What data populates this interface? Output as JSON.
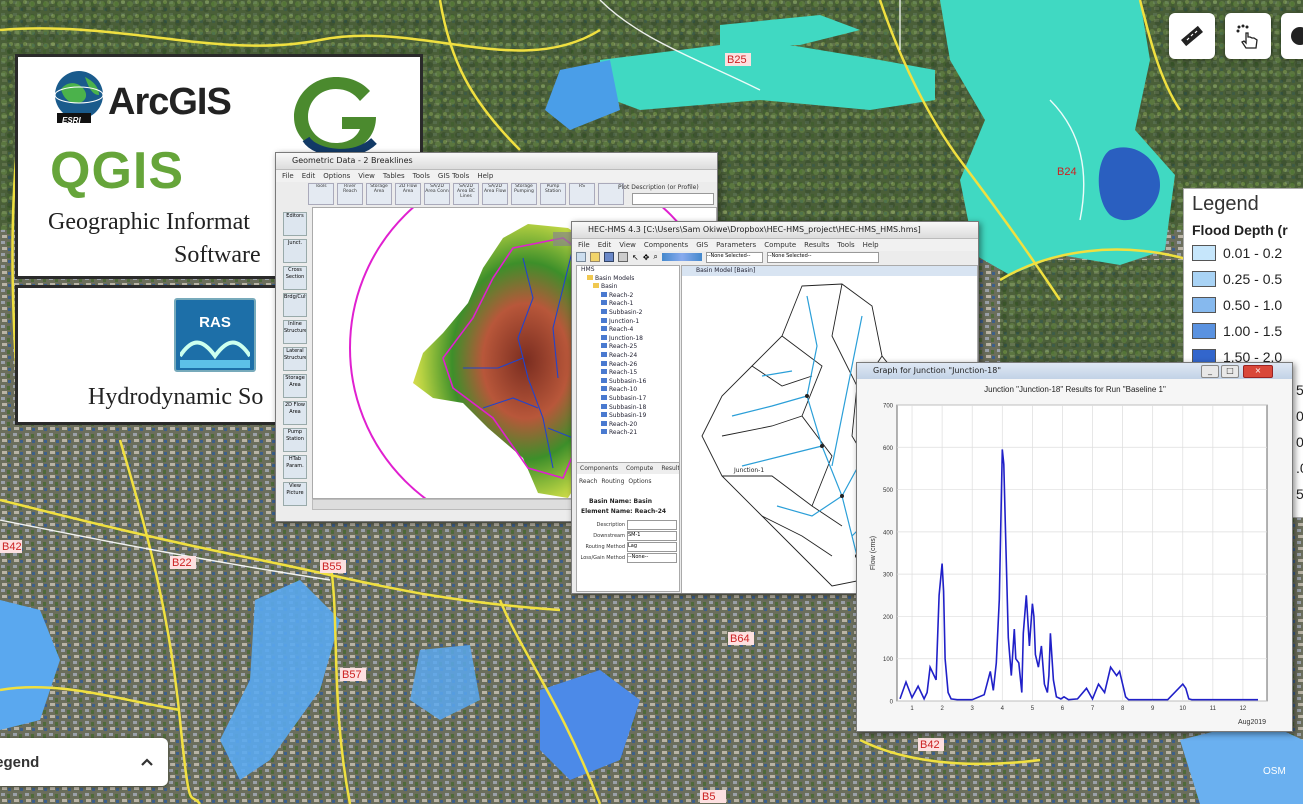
{
  "map": {
    "region_labels": [
      "B25",
      "B24",
      "B22",
      "B42",
      "B55",
      "B64",
      "B57",
      "B42",
      "B5"
    ],
    "osm_badge": "OSM",
    "legend_bar": {
      "label": "Legend"
    }
  },
  "legend_panel": {
    "title": "Legend",
    "subtitle": "Flood Depth (r",
    "items": [
      {
        "label": "0.01 - 0.2",
        "color": "#c6e6fb"
      },
      {
        "label": "0.25 - 0.5",
        "color": "#a9d3f5"
      },
      {
        "label": "0.50 - 1.0",
        "color": "#86b9ee"
      },
      {
        "label": "1.00 - 1.5",
        "color": "#5a92e0"
      },
      {
        "label": "1.50 - 2.0",
        "color": "#3366cc"
      }
    ],
    "clipped_digits": [
      "5",
      "0",
      "0",
      ".0",
      "5.0"
    ]
  },
  "software_panel": {
    "arcgis_label": "ArcGIS",
    "esri_label": "ESRI",
    "qgis_label": "QGIS",
    "caption_line1": "Geographic Informat",
    "caption_line2": "Software"
  },
  "hydro_panel": {
    "ras_label": "RAS",
    "caption": "Hydrodynamic So"
  },
  "geometric_window": {
    "title": "Geometric Data - 2 Breaklines",
    "menu": [
      "File",
      "Edit",
      "Options",
      "View",
      "Tables",
      "Tools",
      "GIS Tools",
      "Help"
    ],
    "tool_tabs": [
      "Tools",
      "River Reach",
      "Storage Area",
      "2D Flow Area",
      "SA/2D Area Conn",
      "SA/2D Area BC Lines",
      "SA/2D Area Flow",
      "Storage Pumping",
      "Pump Station",
      "RS",
      ""
    ],
    "profile_label": "Plot Description (or Profile)",
    "side_tools": [
      "Editors",
      "Junct.",
      "Cross Section",
      "Brdg/Culv",
      "Inline Structure",
      "Lateral Structure",
      "Storage Area",
      "2D Flow Area",
      "Pump Station",
      "HTab Param.",
      "View Picture"
    ]
  },
  "hms_window": {
    "title": "HEC-HMS 4.3 [C:\\Users\\Sam Okiwe\\Dropbox\\HEC-HMS_project\\HEC-HMS_HMS.hms]",
    "menu": [
      "File",
      "Edit",
      "View",
      "Components",
      "GIS",
      "Parameters",
      "Compute",
      "Results",
      "Tools",
      "Help"
    ],
    "dropdown1": "--None Selected--",
    "dropdown2": "--None Selected--",
    "tree_root": "HMS",
    "tree": [
      "Basin Models",
      "Basin",
      "Reach-2",
      "Reach-1",
      "Subbasin-2",
      "Junction-1",
      "Reach-4",
      "Junction-18",
      "Reach-25",
      "Reach-24",
      "Reach-26",
      "Reach-15",
      "Subbasin-16",
      "Reach-10",
      "Subbasin-17",
      "Subbasin-18",
      "Subbasin-19",
      "Reach-20",
      "Reach-21"
    ],
    "tabs": [
      "Components",
      "Compute",
      "Results"
    ],
    "prop_tabs": [
      "Reach",
      "Routing",
      "Options"
    ],
    "basin_name_label": "Basin Name: Basin",
    "element_name_label": "Element Name: Reach-24",
    "fields": [
      {
        "label": "Description",
        "value": ""
      },
      {
        "label": "Downstream",
        "value": "SM-1"
      },
      {
        "label": "Routing Method",
        "value": "Lag"
      },
      {
        "label": "Loss/Gain Method",
        "value": "--None--"
      }
    ],
    "basin_view_title": "Basin Model [Basin]",
    "junction_label": "Junction-1"
  },
  "graph_window": {
    "title": "Graph for Junction \"Junction-18\"",
    "buttons": [
      "_",
      "□",
      "×"
    ]
  },
  "chart_data": {
    "type": "line",
    "title": "Junction \"Junction-18\" Results for Run \"Baseline 1\"",
    "ylabel": "Flow (cms)",
    "xlabel": "Aug2019",
    "x_ticks": [
      "1",
      "2",
      "3",
      "4",
      "5",
      "6",
      "7",
      "8",
      "9",
      "10",
      "11",
      "12"
    ],
    "y_ticks": [
      "0",
      "100",
      "200",
      "300",
      "400",
      "500",
      "600",
      "700"
    ],
    "xlim": [
      0.5,
      12.8
    ],
    "ylim": [
      0,
      700
    ],
    "color": "#2020c8",
    "series": [
      {
        "x": [
          0.6,
          0.8,
          1.0,
          1.2,
          1.4,
          1.5,
          1.6,
          1.8,
          1.9,
          2.0,
          2.05,
          2.1,
          2.2,
          2.3,
          2.5,
          3.0,
          3.4,
          3.6,
          3.7,
          3.8,
          3.9,
          4.0,
          4.05,
          4.1,
          4.2,
          4.3,
          4.4,
          4.45,
          4.55,
          4.65,
          4.7,
          4.8,
          4.9,
          5.0,
          5.05,
          5.1,
          5.2,
          5.3,
          5.4,
          5.5,
          5.55,
          5.6,
          5.7,
          5.8,
          5.95,
          6.05,
          6.2,
          6.5,
          6.8,
          7.0,
          7.2,
          7.4,
          7.6,
          7.8,
          7.9,
          8.0,
          8.1,
          8.2,
          8.4,
          8.6,
          9.0,
          9.5,
          10.0,
          10.1,
          10.2,
          10.3,
          10.5,
          11.0,
          11.5,
          12.0,
          12.5
        ],
        "y": [
          5,
          45,
          8,
          35,
          5,
          20,
          80,
          50,
          250,
          325,
          260,
          100,
          20,
          5,
          3,
          3,
          15,
          70,
          25,
          90,
          240,
          595,
          560,
          420,
          150,
          60,
          170,
          100,
          90,
          20,
          160,
          250,
          130,
          230,
          200,
          110,
          80,
          130,
          40,
          20,
          60,
          160,
          50,
          10,
          5,
          10,
          3,
          5,
          30,
          5,
          40,
          20,
          80,
          60,
          70,
          40,
          10,
          3,
          3,
          3,
          3,
          3,
          40,
          30,
          5,
          3,
          3,
          3,
          3,
          3,
          3
        ]
      }
    ]
  }
}
